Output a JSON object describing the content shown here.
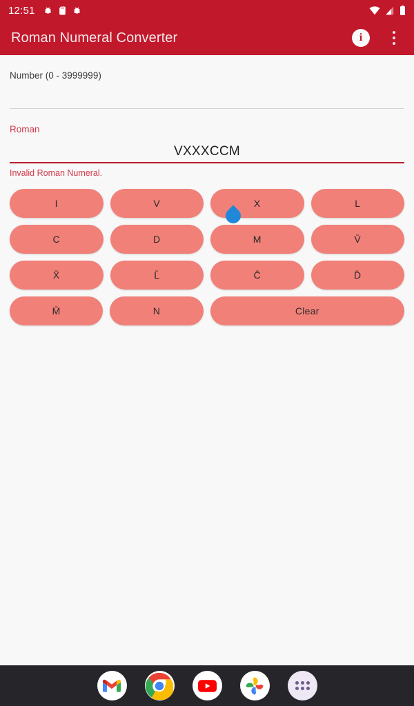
{
  "status_bar": {
    "clock": "12:51",
    "left_icons": [
      "bug-icon",
      "sd-card-icon",
      "bug-icon"
    ],
    "right_icons": [
      "wifi-icon",
      "cellular-signal-icon",
      "battery-icon"
    ],
    "background_color": "#C2182B"
  },
  "app_bar": {
    "title": "Roman Numeral Converter",
    "info_label": "i",
    "info_icon": "info-icon",
    "overflow_icon": "more-vert-icon",
    "background_color": "#C2182B",
    "title_color": "#F5E9EA"
  },
  "form": {
    "number_field": {
      "label": "Number (0 - 3999999)",
      "value": "",
      "placeholder": "",
      "underline_color": "#D2D2D2"
    },
    "roman_field": {
      "label": "Roman",
      "value": "VXXXCCM",
      "placeholder": "",
      "error_text": "Invalid Roman Numeral.",
      "error_color": "#D1394A",
      "underline_color": "#B71C2B",
      "cursor_handle_color": "#2188D9"
    }
  },
  "keypad": {
    "button_color": "#F08078",
    "text_color": "#2A2A2A",
    "rows": [
      [
        {
          "label": "I",
          "name": "key-i",
          "wide": false
        },
        {
          "label": "V",
          "name": "key-v",
          "wide": false
        },
        {
          "label": "X",
          "name": "key-x",
          "wide": false
        },
        {
          "label": "L",
          "name": "key-l",
          "wide": false
        }
      ],
      [
        {
          "label": "C",
          "name": "key-c",
          "wide": false
        },
        {
          "label": "D",
          "name": "key-d",
          "wide": false
        },
        {
          "label": "M",
          "name": "key-m",
          "wide": false
        },
        {
          "label": "V̄",
          "name": "key-v-bar",
          "wide": false
        }
      ],
      [
        {
          "label": "X̄",
          "name": "key-x-bar",
          "wide": false
        },
        {
          "label": "L̄",
          "name": "key-l-bar",
          "wide": false
        },
        {
          "label": "C̄",
          "name": "key-c-bar",
          "wide": false
        },
        {
          "label": "D̄",
          "name": "key-d-bar",
          "wide": false
        }
      ],
      [
        {
          "label": "M̄",
          "name": "key-m-bar",
          "wide": false
        },
        {
          "label": "N",
          "name": "key-n",
          "wide": false
        },
        {
          "label": "Clear",
          "name": "clear-button",
          "wide": true
        }
      ]
    ]
  },
  "dock": {
    "background_color": "#26262A",
    "items": [
      {
        "name": "gmail-icon",
        "label": "Gmail"
      },
      {
        "name": "chrome-icon",
        "label": "Chrome"
      },
      {
        "name": "youtube-icon",
        "label": "YouTube"
      },
      {
        "name": "google-photos-icon",
        "label": "Photos"
      },
      {
        "name": "app-drawer-icon",
        "label": "All apps"
      }
    ]
  }
}
